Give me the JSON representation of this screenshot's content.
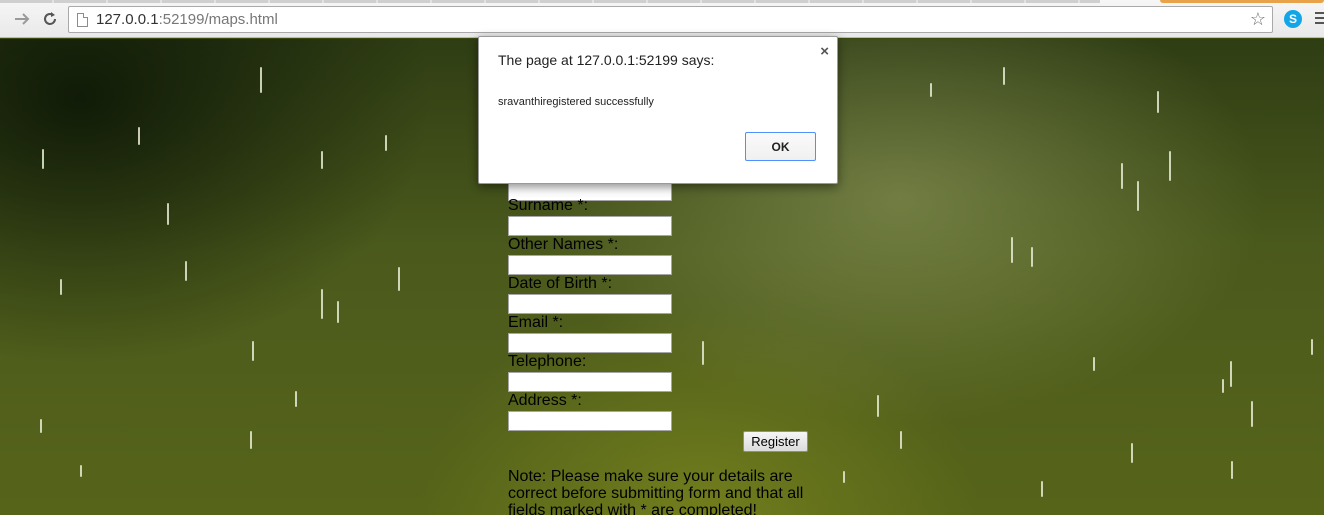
{
  "browser": {
    "url_host": "127.0.0.1",
    "url_rest": ":52199/maps.html",
    "icons": {
      "back": "back-arrow-icon",
      "reload": "reload-icon",
      "page": "page-icon",
      "bookmark": "star-icon",
      "extension": "skype-icon",
      "menu": "menu-icon"
    },
    "skype_glyph": "S"
  },
  "form": {
    "fields": [
      {
        "label": "Surname *:"
      },
      {
        "label": "Other Names *:"
      },
      {
        "label": "Date of Birth *:"
      },
      {
        "label": "Email *:"
      },
      {
        "label": "Telephone:"
      },
      {
        "label": "Address *:"
      }
    ],
    "register_label": "Register",
    "note": "Note: Please make sure your details are correct before submitting form and that all fields marked with * are completed!"
  },
  "alert": {
    "title": "The page at 127.0.0.1:52199 says:",
    "message": "sravanthiregistered successfully",
    "ok_label": "OK",
    "close_glyph": "×"
  },
  "colors": {
    "dialog_focus": "#4d90fe",
    "skype": "#12a5e8",
    "background_green": "#4b5a1c"
  }
}
